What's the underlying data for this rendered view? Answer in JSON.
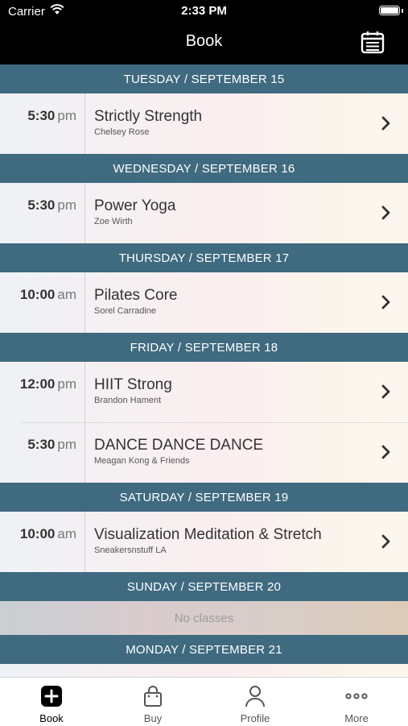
{
  "status_bar": {
    "carrier": "Carrier",
    "time": "2:33 PM"
  },
  "nav": {
    "title": "Book",
    "calendar_icon": "calendar-icon"
  },
  "schedule": {
    "days": [
      {
        "header": "TUESDAY / SEPTEMBER 15",
        "classes": [
          {
            "time": "5:30",
            "ampm": "pm",
            "name": "Strictly Strength",
            "instructor": "Chelsey Rose"
          }
        ]
      },
      {
        "header": "WEDNESDAY / SEPTEMBER 16",
        "classes": [
          {
            "time": "5:30",
            "ampm": "pm",
            "name": "Power Yoga",
            "instructor": "Zoe Wirth"
          }
        ]
      },
      {
        "header": "THURSDAY / SEPTEMBER 17",
        "classes": [
          {
            "time": "10:00",
            "ampm": "am",
            "name": "Pilates Core",
            "instructor": "Sorel Carradine"
          }
        ]
      },
      {
        "header": "FRIDAY / SEPTEMBER 18",
        "classes": [
          {
            "time": "12:00",
            "ampm": "pm",
            "name": "HIIT Strong",
            "instructor": "Brandon Hament"
          },
          {
            "time": "5:30",
            "ampm": "pm",
            "name": "DANCE DANCE DANCE",
            "instructor": "Meagan Kong & Friends"
          }
        ]
      },
      {
        "header": "SATURDAY / SEPTEMBER 19",
        "classes": [
          {
            "time": "10:00",
            "ampm": "am",
            "name": "Visualization Meditation & Stretch",
            "instructor": "Sneakersnstuff LA"
          }
        ]
      },
      {
        "header": "SUNDAY / SEPTEMBER 20",
        "empty_text": "No classes",
        "classes": []
      },
      {
        "header": "MONDAY / SEPTEMBER 21",
        "classes": []
      }
    ]
  },
  "tabs": [
    {
      "label": "Book",
      "icon": "plus-square-icon",
      "active": true
    },
    {
      "label": "Buy",
      "icon": "shopping-bag-icon",
      "active": false
    },
    {
      "label": "Profile",
      "icon": "person-icon",
      "active": false
    },
    {
      "label": "More",
      "icon": "ellipsis-icon",
      "active": false
    }
  ],
  "colors": {
    "header": "#3f6a80",
    "topbar": "#000000",
    "accent": "#000000"
  }
}
